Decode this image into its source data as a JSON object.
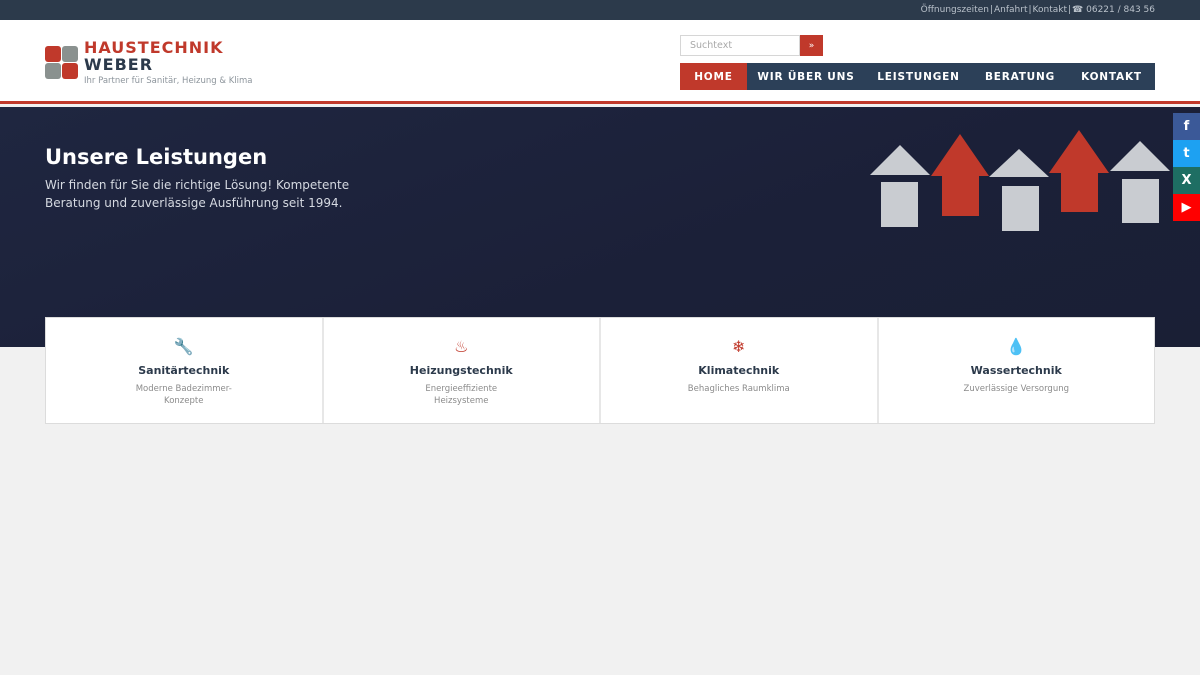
{
  "topbar": {
    "links": [
      "Öffnungszeiten",
      "Anfahrt",
      "Kontakt"
    ],
    "separator": "|",
    "phone": "☎ 06221 / 843 56"
  },
  "logo": {
    "line1": "HAUSTECHNIK",
    "line2": "WEBER",
    "tagline": "Ihr Partner für Sanitär, Heizung & Klima"
  },
  "search": {
    "placeholder": "Suchtext",
    "button_label": "»"
  },
  "nav": {
    "items": [
      {
        "label": "HOME",
        "active": true
      },
      {
        "label": "WIR ÜBER UNS"
      },
      {
        "label": "LEISTUNGEN"
      },
      {
        "label": "BERATUNG"
      },
      {
        "label": "KONTAKT"
      }
    ]
  },
  "hero": {
    "title": "Unsere Leistungen",
    "subtitle": "Wir finden für Sie die richtige Lösung! Kompetente Beratung und zuverlässige Ausführung seit 1994."
  },
  "social": [
    "f",
    "t",
    "X",
    "▶"
  ],
  "cards": [
    {
      "icon": "wrench-icon",
      "glyph": "🔧",
      "title": "Sanitärtechnik",
      "desc": "Moderne Badezimmer-Konzepte"
    },
    {
      "icon": "flame-icon",
      "glyph": "♨",
      "title": "Heizungstechnik",
      "desc": "Energieeffiziente Heizsysteme"
    },
    {
      "icon": "snowflake-icon",
      "glyph": "❄",
      "title": "Klimatechnik",
      "desc": "Behagliches Raumklima"
    },
    {
      "icon": "water-drop-icon",
      "glyph": "💧",
      "title": "Wassertechnik",
      "desc": "Zuverlässige Versorgung"
    }
  ],
  "colors": {
    "accent": "#c0392b",
    "nav_bg": "#2c4058",
    "topbar_bg": "#2c3a4b",
    "hero_bg": "#1c2139"
  }
}
